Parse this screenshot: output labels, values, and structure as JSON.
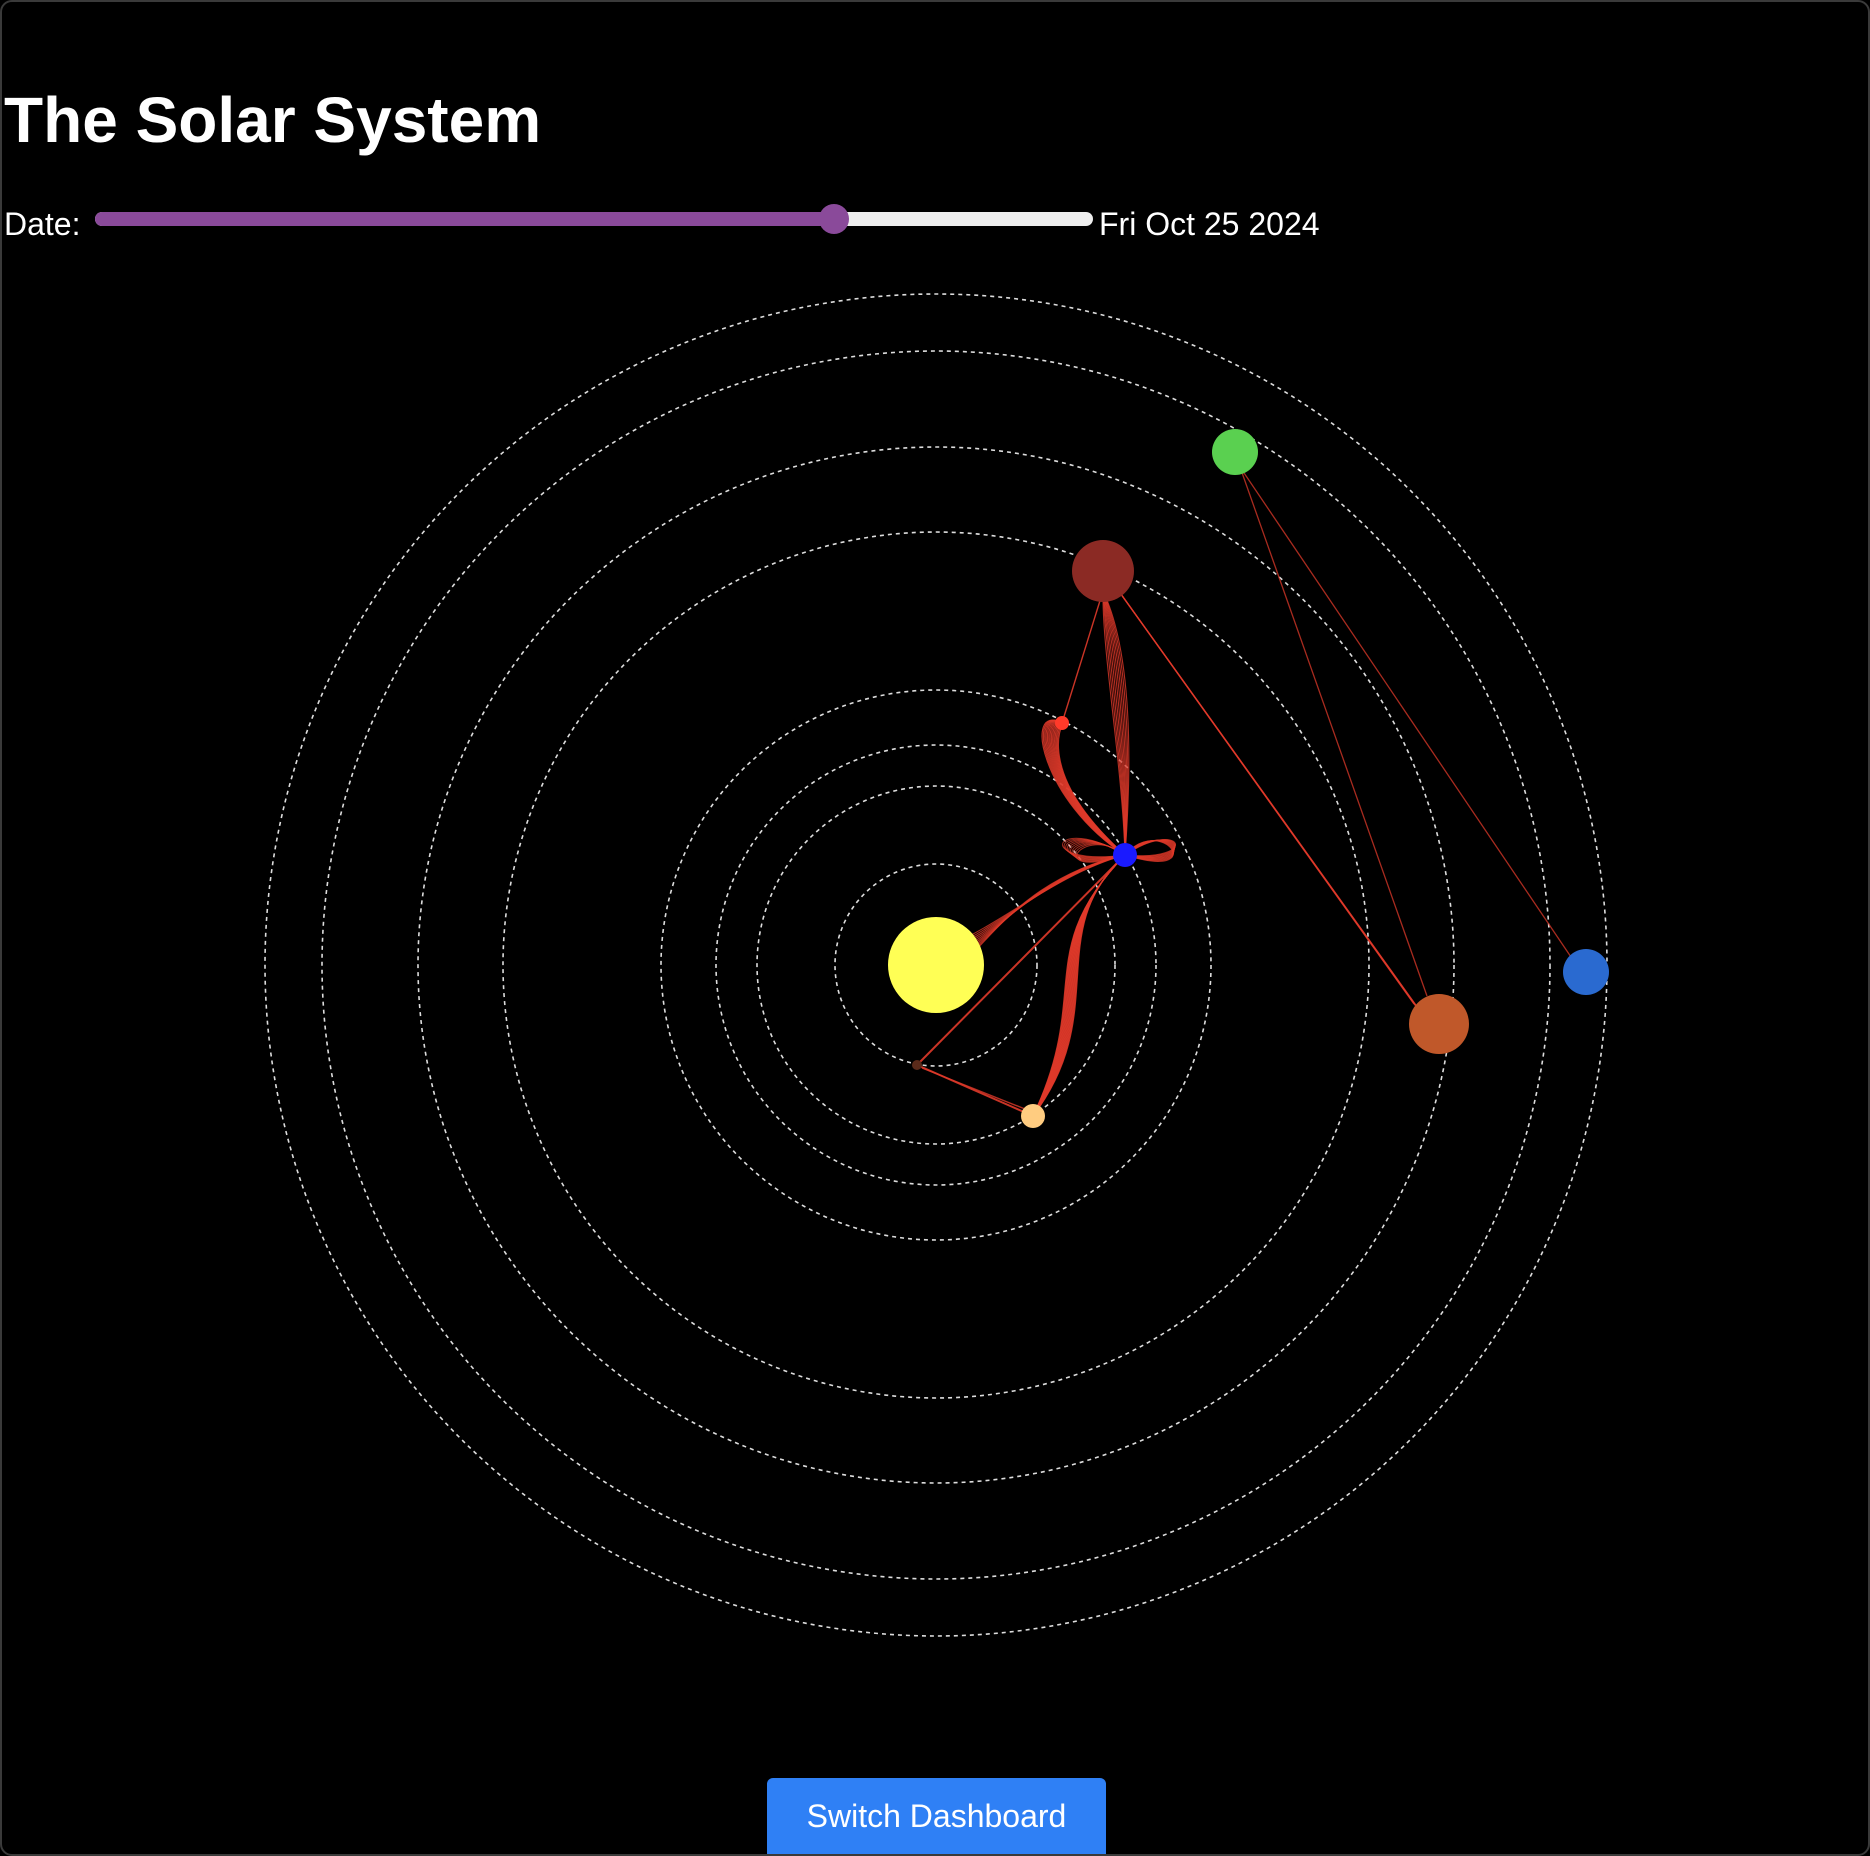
{
  "header": {
    "title": "The Solar System"
  },
  "date_control": {
    "label": "Date:",
    "value_text": "Fri Oct 25 2024",
    "slider_progress": 0.74,
    "fill_color": "#8a4a9a",
    "track_color": "#eeeeee"
  },
  "footer": {
    "switch_label": "Switch Dashboard",
    "switch_color": "#2f80f5"
  },
  "scene": {
    "orbit_color": "#dddddd",
    "trail_color": "#e03a2a",
    "sun": {
      "name": "sun",
      "color": "#ffff55"
    },
    "bodies": [
      {
        "name": "mercury",
        "color": "#5a2a1a"
      },
      {
        "name": "venus",
        "color": "#ffcc80"
      },
      {
        "name": "earth",
        "color": "#1a1aff"
      },
      {
        "name": "earth-moon",
        "color": "#ff3a2a"
      },
      {
        "name": "mars",
        "color": "#8b2a24"
      },
      {
        "name": "jupiter",
        "color": "#c0582a"
      },
      {
        "name": "saturn",
        "color": "#5ad050"
      },
      {
        "name": "uranus",
        "color": "#2a6ad0"
      }
    ]
  }
}
